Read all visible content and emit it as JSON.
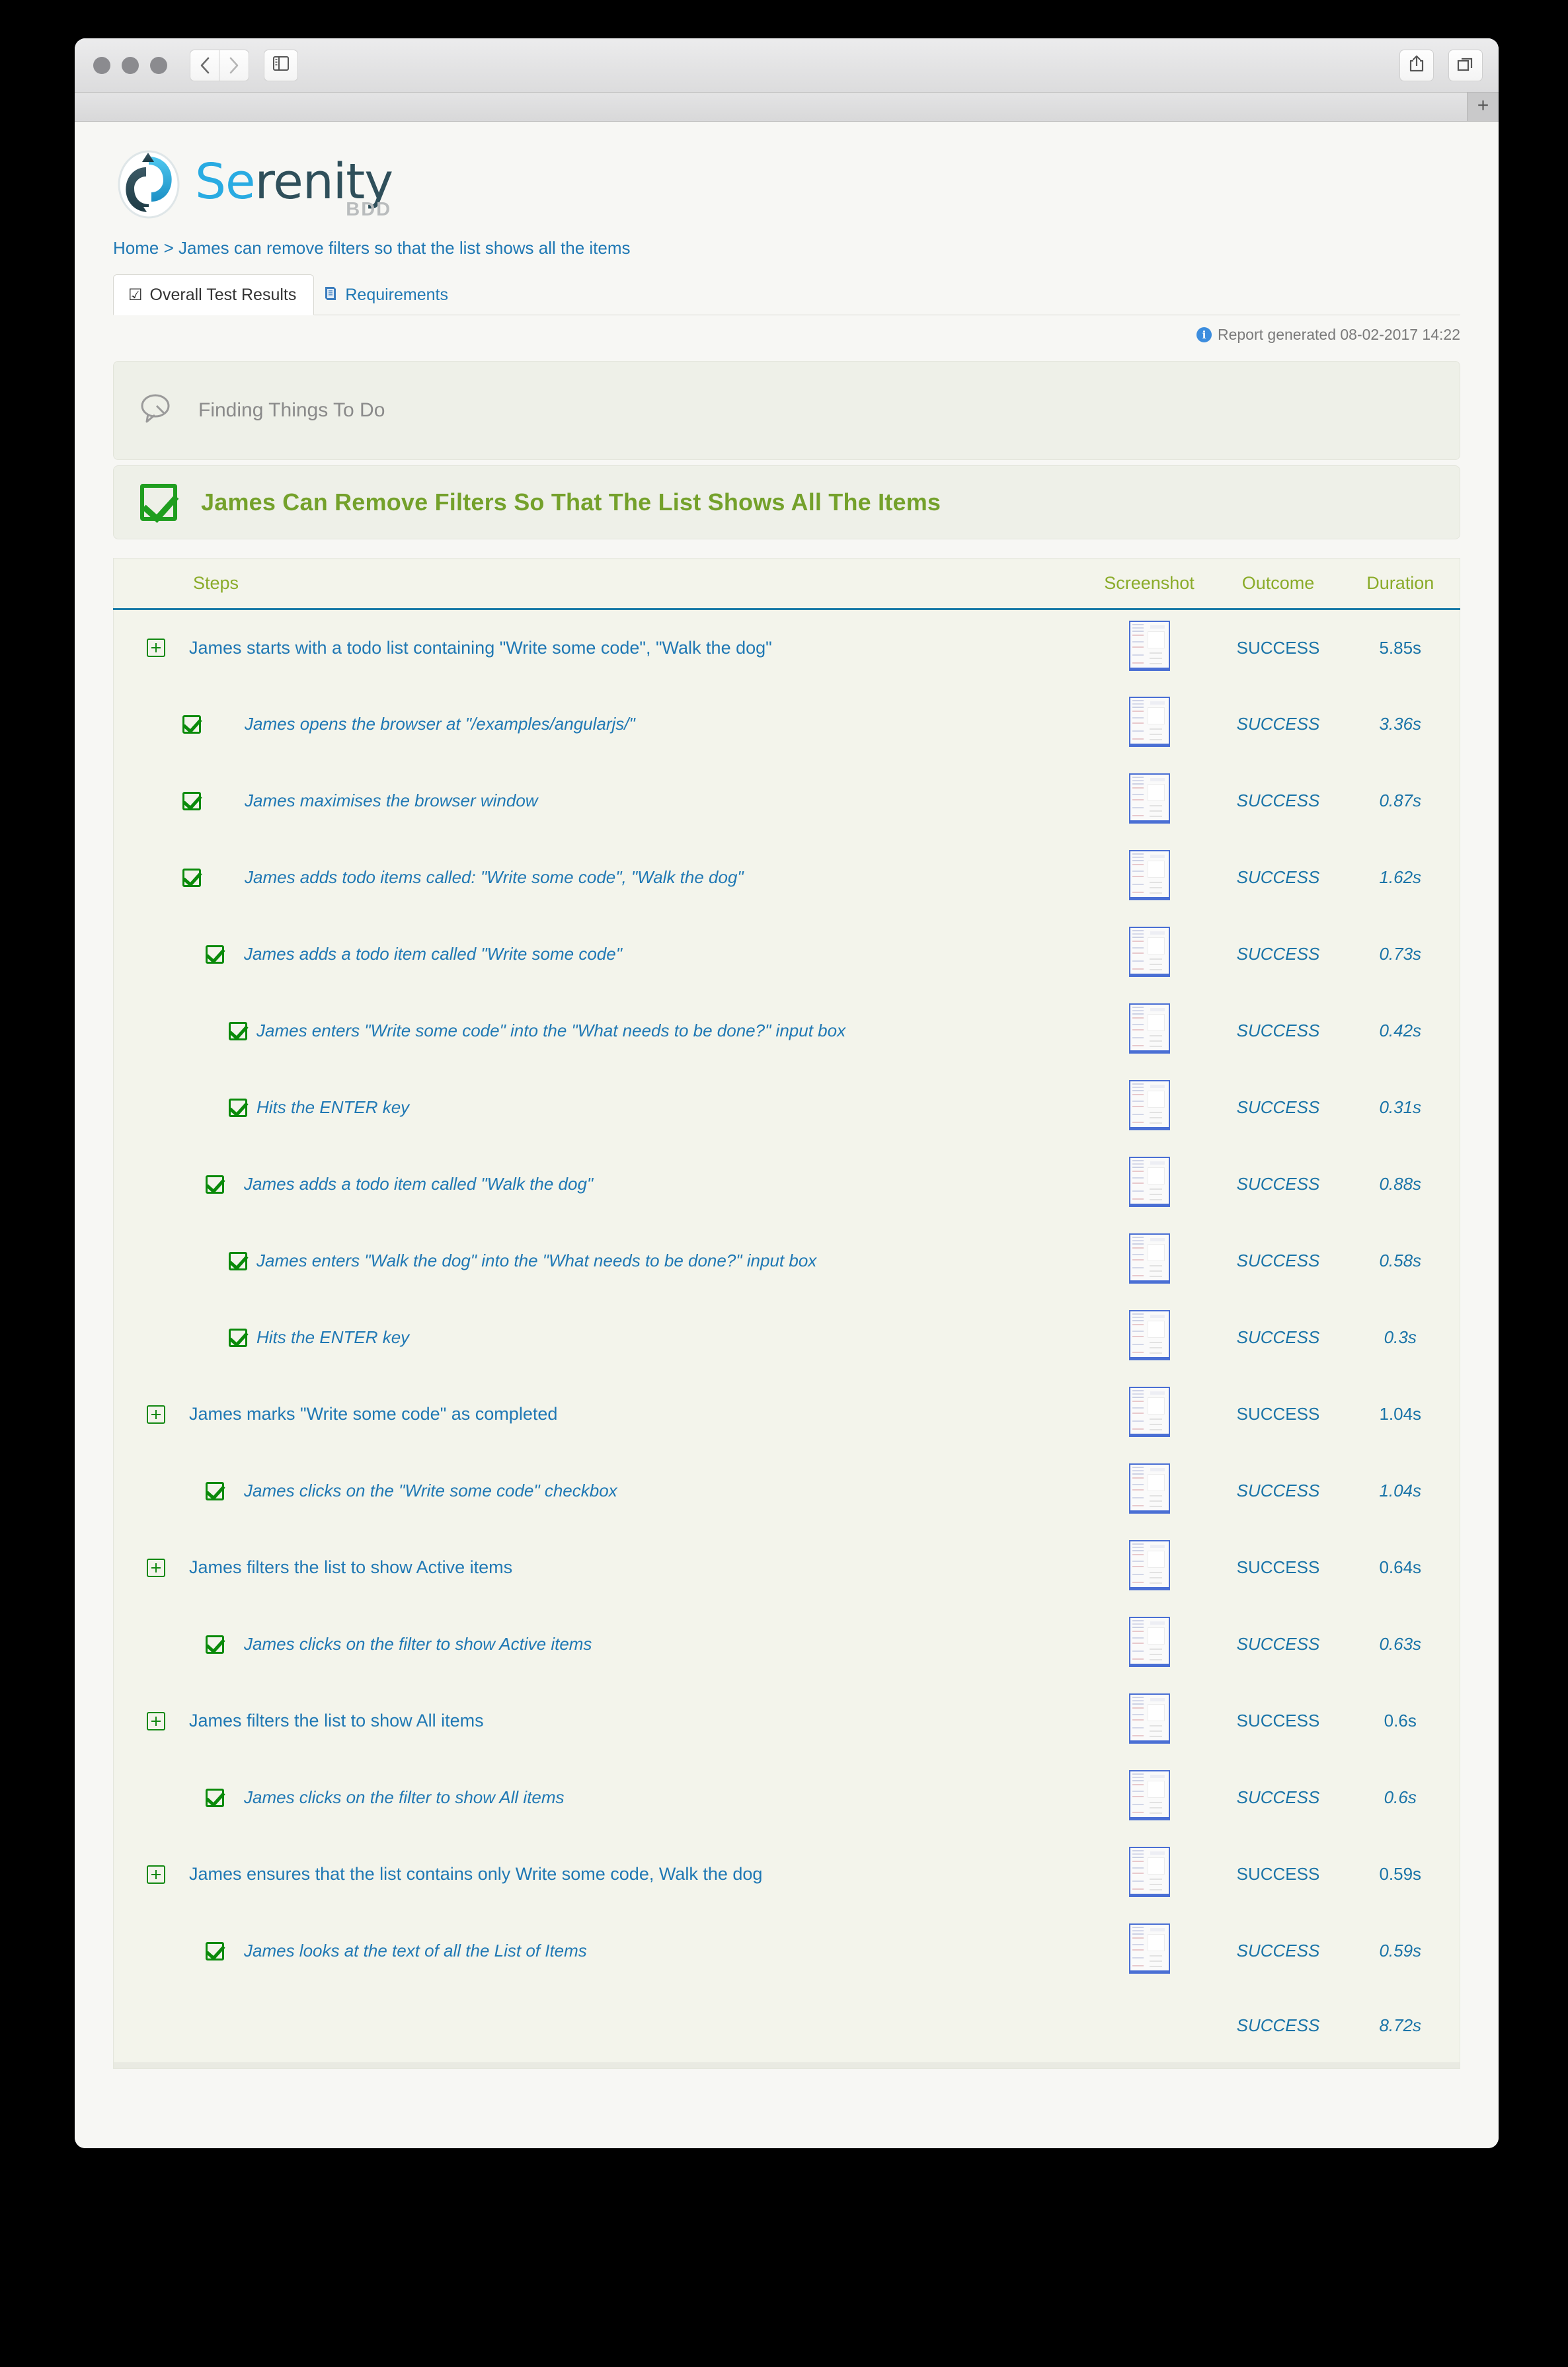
{
  "browser": {
    "back_icon": "‹",
    "forward_icon": "›",
    "sidebar_icon": "sidebar",
    "share_icon": "share",
    "tabs_icon": "tabs",
    "new_tab_label": "+"
  },
  "logo": {
    "part1": "Se",
    "part2": "renity",
    "subtitle": "BDD",
    "accent_blue": "#29ABE2",
    "accent_dark": "#2f4f5a"
  },
  "breadcrumb": {
    "home": "Home",
    "separator": ">",
    "current": "James can remove filters so that the list shows all the items"
  },
  "tabs": [
    {
      "label": "Overall Test Results",
      "icon": "checkbox-icon",
      "active": true
    },
    {
      "label": "Requirements",
      "icon": "book-icon",
      "active": false
    }
  ],
  "report_generated": "Report generated 08-02-2017 14:22",
  "feature": {
    "icon": "speech-bubble-icon",
    "name": "Finding Things To Do"
  },
  "scenario": {
    "icon": "success-check-icon",
    "title": "James Can Remove Filters So That The List Shows All The Items",
    "title_color": "#74a12b"
  },
  "table": {
    "headers": {
      "steps": "Steps",
      "screenshot": "Screenshot",
      "outcome": "Outcome",
      "duration": "Duration"
    },
    "rows": [
      {
        "level": 0,
        "icon": "expand-plus-icon",
        "label": "James starts with a todo list containing \"Write some code\", \"Walk the dog\"",
        "screenshot": "thumbnail",
        "outcome": "SUCCESS",
        "duration": "5.85s"
      },
      {
        "level": 1,
        "icon": "success-check-icon",
        "label": "James opens the browser at \"/examples/angularjs/\"",
        "screenshot": "thumbnail",
        "outcome": "SUCCESS",
        "duration": "3.36s"
      },
      {
        "level": 1,
        "icon": "success-check-icon",
        "label": "James maximises the browser window",
        "screenshot": "thumbnail",
        "outcome": "SUCCESS",
        "duration": "0.87s"
      },
      {
        "level": 1,
        "icon": "success-check-icon",
        "label": "James adds todo items called: \"Write some code\", \"Walk the dog\"",
        "screenshot": "thumbnail",
        "outcome": "SUCCESS",
        "duration": "1.62s"
      },
      {
        "level": 2,
        "icon": "success-check-icon",
        "label": "James adds a todo item called \"Write some code\"",
        "screenshot": "thumbnail",
        "outcome": "SUCCESS",
        "duration": "0.73s"
      },
      {
        "level": 3,
        "icon": "success-check-icon",
        "label": "James enters \"Write some code\" into the \"What needs to be done?\" input box",
        "screenshot": "thumbnail",
        "outcome": "SUCCESS",
        "duration": "0.42s"
      },
      {
        "level": 3,
        "icon": "success-check-icon",
        "label": "Hits the ENTER key",
        "screenshot": "thumbnail",
        "outcome": "SUCCESS",
        "duration": "0.31s"
      },
      {
        "level": 2,
        "icon": "success-check-icon",
        "label": "James adds a todo item called \"Walk the dog\"",
        "screenshot": "thumbnail",
        "outcome": "SUCCESS",
        "duration": "0.88s"
      },
      {
        "level": 3,
        "icon": "success-check-icon",
        "label": "James enters \"Walk the dog\" into the \"What needs to be done?\" input box",
        "screenshot": "thumbnail",
        "outcome": "SUCCESS",
        "duration": "0.58s"
      },
      {
        "level": 3,
        "icon": "success-check-icon",
        "label": "Hits the ENTER key",
        "screenshot": "thumbnail",
        "outcome": "SUCCESS",
        "duration": "0.3s"
      },
      {
        "level": 0,
        "icon": "expand-plus-icon",
        "label": "James marks \"Write some code\" as completed",
        "screenshot": "thumbnail",
        "outcome": "SUCCESS",
        "duration": "1.04s"
      },
      {
        "level": 2,
        "icon": "success-check-icon",
        "label": "James clicks on the \"Write some code\" checkbox",
        "screenshot": "thumbnail",
        "outcome": "SUCCESS",
        "duration": "1.04s"
      },
      {
        "level": 0,
        "icon": "expand-plus-icon",
        "label": "James filters the list to show Active items",
        "screenshot": "thumbnail",
        "outcome": "SUCCESS",
        "duration": "0.64s"
      },
      {
        "level": 2,
        "icon": "success-check-icon",
        "label": "James clicks on the filter to show Active items",
        "screenshot": "thumbnail",
        "outcome": "SUCCESS",
        "duration": "0.63s"
      },
      {
        "level": 0,
        "icon": "expand-plus-icon",
        "label": "James filters the list to show All items",
        "screenshot": "thumbnail",
        "outcome": "SUCCESS",
        "duration": "0.6s"
      },
      {
        "level": 2,
        "icon": "success-check-icon",
        "label": "James clicks on the filter to show All items",
        "screenshot": "thumbnail",
        "outcome": "SUCCESS",
        "duration": "0.6s"
      },
      {
        "level": 0,
        "icon": "expand-plus-icon",
        "label": "James ensures that the list contains only Write some code, Walk the dog",
        "screenshot": "thumbnail",
        "outcome": "SUCCESS",
        "duration": "0.59s"
      },
      {
        "level": 2,
        "icon": "success-check-icon",
        "label": "James looks at the text of all the List of Items",
        "screenshot": "thumbnail",
        "outcome": "SUCCESS",
        "duration": "0.59s"
      }
    ],
    "summary": {
      "outcome": "SUCCESS",
      "duration": "8.72s"
    }
  }
}
